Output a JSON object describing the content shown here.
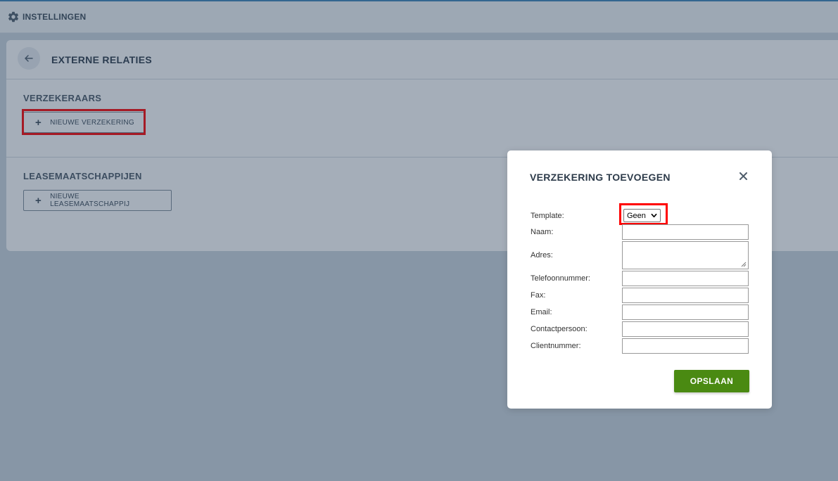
{
  "topbar": {
    "title": "INSTELLINGEN",
    "icon": "gear-icon"
  },
  "page": {
    "title": "EXTERNE RELATIES",
    "sections": [
      {
        "label": "VERZEKERAARS",
        "button": "NIEUWE VERZEKERING"
      },
      {
        "label": "LEASEMAATSCHAPPIJEN",
        "button": "NIEUWE LEASEMAATSCHAPPIJ"
      }
    ]
  },
  "modal": {
    "title": "VERZEKERING TOEVOEGEN",
    "fields": {
      "template": {
        "label": "Template:",
        "selected": "Geen"
      },
      "naam": {
        "label": "Naam:",
        "value": ""
      },
      "adres": {
        "label": "Adres:",
        "value": ""
      },
      "telefoon": {
        "label": "Telefoonnummer:",
        "value": ""
      },
      "fax": {
        "label": "Fax:",
        "value": ""
      },
      "email": {
        "label": "Email:",
        "value": ""
      },
      "contact": {
        "label": "Contactpersoon:",
        "value": ""
      },
      "client": {
        "label": "Clientnummer:",
        "value": ""
      }
    },
    "save_label": "OPSLAAN"
  },
  "colors": {
    "accent_line": "#3d84b8",
    "save_button": "#4a8a12",
    "highlight": "#ff0000"
  }
}
